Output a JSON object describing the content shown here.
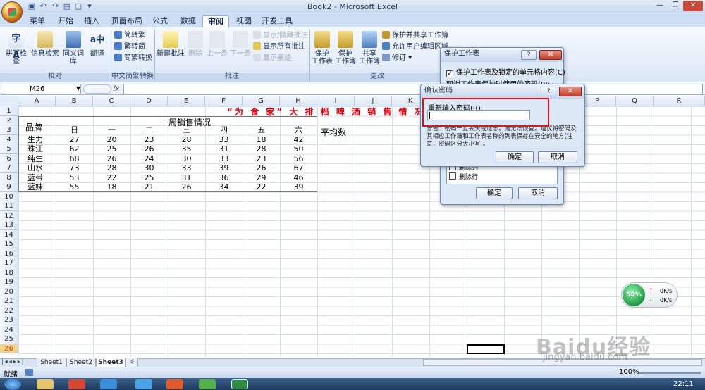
{
  "window": {
    "title": "Book2 - Microsoft Excel"
  },
  "ribbon": {
    "tabs": [
      "菜单",
      "开始",
      "插入",
      "页面布局",
      "公式",
      "数据",
      "审阅",
      "视图",
      "开发工具"
    ],
    "active_tab": "审阅",
    "proofing": {
      "spell": "拼写检查",
      "research": "信息检索",
      "thesaurus": "同义词库",
      "translate": "翻译",
      "label": "校对"
    },
    "chinese": {
      "to_trad": "简转繁",
      "to_simp": "繁转简",
      "convert": "简繁转换",
      "label": "中文简繁转换"
    },
    "comments": {
      "new": "新建批注",
      "delete": "删除",
      "prev": "上一条",
      "next": "下一条",
      "showhide": "显示/隐藏批注",
      "showall": "显示所有批注",
      "ink": "显示墨迹",
      "label": "批注"
    },
    "changes": {
      "protect_sheet": "保护\n工作表",
      "protect_book": "保护\n工作簿",
      "share": "共享\n工作簿",
      "protect_share": "保护并共享工作簿",
      "allow_edit": "允许用户编辑区域",
      "track": "修订",
      "label": "更改"
    }
  },
  "formula_bar": {
    "name_box": "M26",
    "fx": "fx",
    "value": ""
  },
  "columns": [
    "A",
    "B",
    "C",
    "D",
    "E",
    "F",
    "G",
    "H",
    "I",
    "J",
    "K",
    "L",
    "M",
    "N",
    "O",
    "P",
    "Q",
    "R"
  ],
  "rows": [
    "1",
    "2",
    "3",
    "4",
    "5",
    "6",
    "7",
    "8",
    "9",
    "10",
    "11",
    "12",
    "13",
    "14",
    "15",
    "16",
    "17",
    "18",
    "19",
    "20",
    "21",
    "22",
    "23",
    "24",
    "25",
    "26"
  ],
  "sheet": {
    "title": "“为 食 家” 大 排 档 啤 酒 销 售 情 况 表",
    "subtitle": "一周销售情况",
    "brand_header": "品牌",
    "avg_header": "平均数",
    "days": [
      "日",
      "一",
      "二",
      "三",
      "四",
      "五",
      "六"
    ],
    "data": [
      {
        "brand": "生力",
        "v": [
          "27",
          "20",
          "23",
          "28",
          "33",
          "18",
          "42"
        ]
      },
      {
        "brand": "珠江",
        "v": [
          "62",
          "25",
          "26",
          "35",
          "31",
          "28",
          "50"
        ]
      },
      {
        "brand": "纯生",
        "v": [
          "68",
          "26",
          "24",
          "30",
          "33",
          "23",
          "56"
        ]
      },
      {
        "brand": "山水",
        "v": [
          "73",
          "28",
          "30",
          "33",
          "39",
          "26",
          "67"
        ]
      },
      {
        "brand": "蓝带",
        "v": [
          "53",
          "22",
          "25",
          "31",
          "36",
          "29",
          "46"
        ]
      },
      {
        "brand": "蓝妹",
        "v": [
          "55",
          "18",
          "21",
          "26",
          "34",
          "22",
          "39"
        ]
      }
    ]
  },
  "sheet_tabs": [
    "Sheet1",
    "Sheet2",
    "Sheet3"
  ],
  "status": {
    "ready": "就绪",
    "zoom": "100%",
    "clock": "22:11"
  },
  "protect_dialog": {
    "title": "保护工作表",
    "help": "?",
    "check_label": "保护工作表及锁定的单元格内容(C)",
    "pwd_label": "取消工作表保护时使用的密码(P):",
    "opt1": "删除列",
    "opt2": "删除行",
    "ok": "确定",
    "cancel": "取消"
  },
  "confirm_dialog": {
    "title": "确认密码",
    "help": "?",
    "close": "X",
    "label": "重新输入密码(R):",
    "warning": "警告：密码一旦丢失或遗忘，则无法恢复。建议将密码及其相应工作簿和工作表名称的列表保存在安全的地方(注意，密码区分大小写)。",
    "ok": "确定",
    "cancel": "取消"
  },
  "net_widget": {
    "percent": "50%",
    "up": "0K/s",
    "down": "0K/s"
  },
  "watermark": {
    "main": "Baidu经验",
    "sub": "jingyan.baidu.com"
  }
}
